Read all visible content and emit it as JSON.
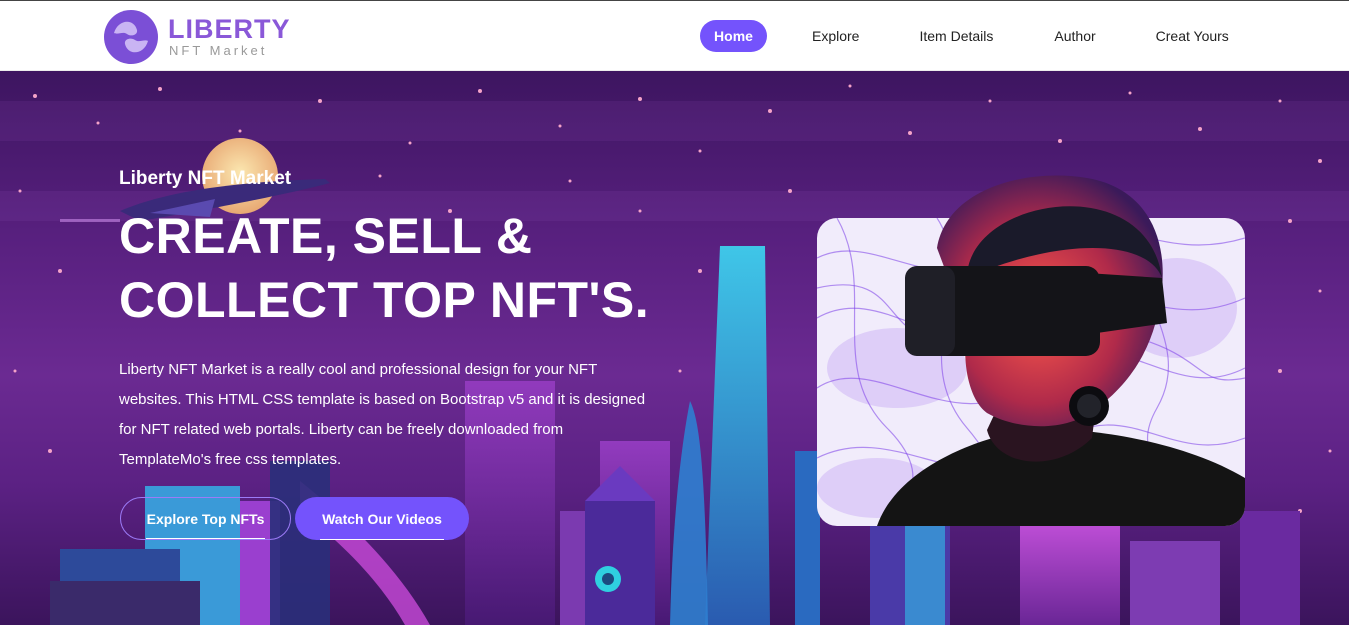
{
  "header": {
    "logo": {
      "title": "LIBERTY",
      "subtitle": "NFT Market"
    },
    "nav": [
      {
        "label": "Home",
        "active": true
      },
      {
        "label": "Explore",
        "active": false
      },
      {
        "label": "Item Details",
        "active": false
      },
      {
        "label": "Author",
        "active": false
      },
      {
        "label": "Creat Yours",
        "active": false
      }
    ]
  },
  "hero": {
    "kicker": "Liberty NFT Market",
    "title_line1": "CREATE, SELL &",
    "title_line2": "COLLECT TOP NFT'S.",
    "description": "Liberty NFT Market is a really cool and professional design for your NFT websites. This HTML CSS template is based on Bootstrap v5 and it is designed for NFT related web portals. Liberty can be freely downloaded from TemplateMo's free css templates.",
    "buttons": {
      "primary": "Explore Top NFTs",
      "secondary": "Watch Our Videos"
    }
  },
  "colors": {
    "accent": "#7453fc",
    "logo": "#8a58d8"
  }
}
